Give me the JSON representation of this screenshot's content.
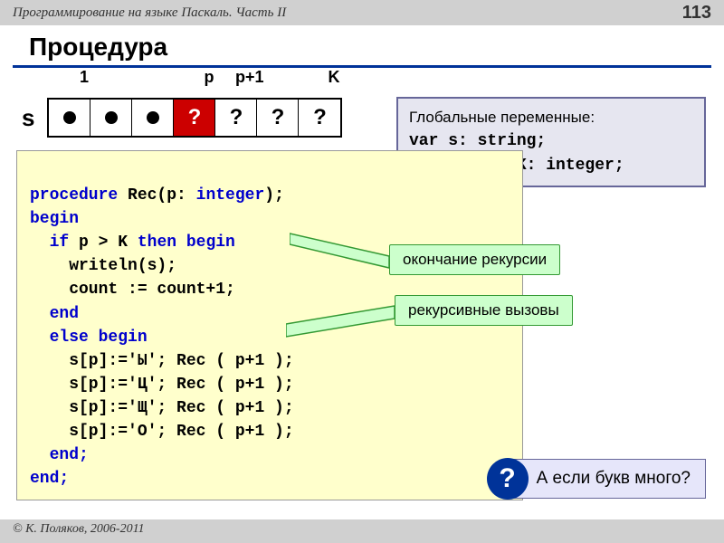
{
  "header": {
    "book": "Программирование на языке Паскаль. Часть II",
    "page": "113"
  },
  "title": "Процедура",
  "array": {
    "label": "s",
    "cols": {
      "c1": "1",
      "cp": "p",
      "cp1": "p+1",
      "cK": "K"
    },
    "qmark": "?"
  },
  "globals": {
    "title": "Глобальные переменные:",
    "line1": "var s: string;",
    "line2": "    count, K: integer;"
  },
  "code": {
    "l1a": "procedure",
    "l1b": " Rec(p: ",
    "l1c": "integer",
    "l1d": ");",
    "l2": "begin",
    "l3a": "  if",
    "l3b": " p > K ",
    "l3c": "then begin",
    "l4": "    writeln(s);",
    "l5": "    count := count+1;",
    "l6": "  end",
    "l7": "  else begin",
    "l8": "    s[p]:='Ы'; Rec ( p+1 );",
    "l9": "    s[p]:='Ц'; Rec ( p+1 );",
    "l10": "    s[p]:='Щ'; Rec ( p+1 );",
    "l11": "    s[p]:='О'; Rec ( p+1 );",
    "l12": "  end;",
    "l13": "end;"
  },
  "callout1": "окончание рекурсии",
  "callout2": "рекурсивные вызовы",
  "question": {
    "mark": "?",
    "text": "А если букв много?"
  },
  "footer": "© К. Поляков, 2006-2011"
}
